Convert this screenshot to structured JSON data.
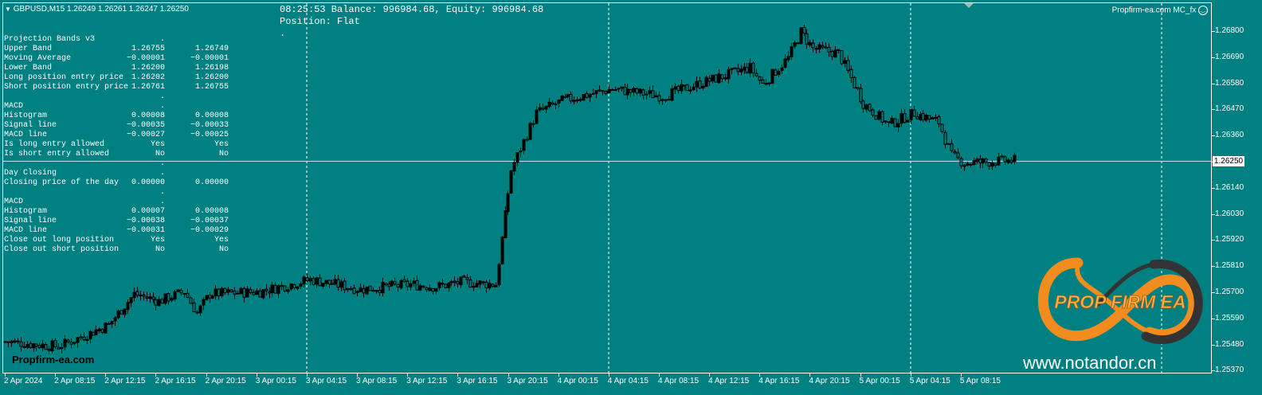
{
  "symbol_header": "GBPUSD,M15  1.26249 1.26261 1.26247 1.26250",
  "status": {
    "line1": "08:25:53 Balance: 996984.68, Equity: 996984.68",
    "line2": "Position: Flat",
    "line3": "."
  },
  "ea_name": "Propfirm-ea.com MC_fx",
  "current_price": "1.26250",
  "watermark_left": "Propfirm-ea.com",
  "watermark_right": "www.notandor.cn",
  "logo_text": "PROP FIRM EA",
  "colors": {
    "background": "#008080",
    "foreground": "#ffffff",
    "logo_orange": "#f28c1e",
    "logo_dark": "#333333"
  },
  "panel": {
    "rows": [
      {
        "label": "Projection Bands v3",
        "v1": ".",
        "v2": ""
      },
      {
        "label": "Upper Band",
        "v1": "1.26755",
        "v2": "1.26749"
      },
      {
        "label": "Moving Average",
        "v1": "−0.00001",
        "v2": "−0.00001"
      },
      {
        "label": "Lower Band",
        "v1": "1.26200",
        "v2": "1.26198"
      },
      {
        "label": "Long position entry price",
        "v1": "1.26202",
        "v2": "1.26200"
      },
      {
        "label": "Short position entry price",
        "v1": "1.26761",
        "v2": "1.26755"
      },
      {
        "label": "",
        "v1": ".",
        "v2": ""
      },
      {
        "label": "MACD",
        "v1": ".",
        "v2": ""
      },
      {
        "label": "Histogram",
        "v1": "0.00008",
        "v2": "0.00008"
      },
      {
        "label": "Signal line",
        "v1": "−0.00035",
        "v2": "−0.00033"
      },
      {
        "label": "MACD line",
        "v1": "−0.00027",
        "v2": "−0.00025"
      },
      {
        "label": "Is long entry allowed",
        "v1": "Yes",
        "v2": "Yes"
      },
      {
        "label": "Is short entry allowed",
        "v1": "No",
        "v2": "No"
      },
      {
        "label": "",
        "v1": ".",
        "v2": ""
      },
      {
        "label": "Day Closing",
        "v1": ".",
        "v2": ""
      },
      {
        "label": "Closing price of the day",
        "v1": "0.00000",
        "v2": "0.00000"
      },
      {
        "label": "",
        "v1": ".",
        "v2": ""
      },
      {
        "label": "MACD",
        "v1": ".",
        "v2": ""
      },
      {
        "label": "Histogram",
        "v1": "0.00007",
        "v2": "0.00008"
      },
      {
        "label": "Signal line",
        "v1": "−0.00038",
        "v2": "−0.00037"
      },
      {
        "label": "MACD line",
        "v1": "−0.00031",
        "v2": "−0.00029"
      },
      {
        "label": "Close out long position",
        "v1": "Yes",
        "v2": "Yes"
      },
      {
        "label": "Close out short position",
        "v1": "No",
        "v2": "No"
      }
    ]
  },
  "price_axis": {
    "ticks": [
      "1.26800",
      "1.26690",
      "1.26580",
      "1.26470",
      "1.26360",
      "1.26250",
      "1.26140",
      "1.26030",
      "1.25920",
      "1.25810",
      "1.25700",
      "1.25590",
      "1.25480",
      "1.25370"
    ]
  },
  "time_axis": {
    "ticks": [
      "2 Apr 2024",
      "2 Apr 08:15",
      "2 Apr 12:15",
      "2 Apr 16:15",
      "2 Apr 20:15",
      "3 Apr 00:15",
      "3 Apr 04:15",
      "3 Apr 08:15",
      "3 Apr 12:15",
      "3 Apr 16:15",
      "3 Apr 20:15",
      "4 Apr 00:15",
      "4 Apr 04:15",
      "4 Apr 08:15",
      "4 Apr 12:15",
      "4 Apr 16:15",
      "4 Apr 20:15",
      "5 Apr 00:15",
      "5 Apr 04:15",
      "5 Apr 08:15"
    ]
  },
  "chart_data": {
    "type": "candlestick",
    "ylim": [
      1.2537,
      1.2685
    ],
    "day_separators": [
      "3 Apr 2024",
      "4 Apr 2024",
      "5 Apr 2024"
    ],
    "close_path": [
      [
        "2 Apr 2024",
        1.2549
      ],
      [
        "2 Apr 04:15",
        1.2547
      ],
      [
        "2 Apr 08:15",
        1.2556
      ],
      [
        "2 Apr 10:15",
        1.2569
      ],
      [
        "2 Apr 12:15",
        1.2566
      ],
      [
        "2 Apr 14:15",
        1.257
      ],
      [
        "2 Apr 15:15",
        1.2561
      ],
      [
        "2 Apr 16:15",
        1.2569
      ],
      [
        "2 Apr 20:15",
        1.257
      ],
      [
        "3 Apr 00:15",
        1.2575
      ],
      [
        "3 Apr 04:15",
        1.2571
      ],
      [
        "3 Apr 08:15",
        1.2573
      ],
      [
        "3 Apr 10:15",
        1.2572
      ],
      [
        "3 Apr 12:15",
        1.2574
      ],
      [
        "3 Apr 15:00",
        1.2573
      ],
      [
        "3 Apr 16:15",
        1.2621
      ],
      [
        "3 Apr 18:15",
        1.2645
      ],
      [
        "3 Apr 20:15",
        1.265
      ],
      [
        "4 Apr 00:15",
        1.2655
      ],
      [
        "4 Apr 04:15",
        1.2652
      ],
      [
        "4 Apr 08:15",
        1.2659
      ],
      [
        "4 Apr 11:15",
        1.2664
      ],
      [
        "4 Apr 12:15",
        1.2657
      ],
      [
        "4 Apr 14:15",
        1.2668
      ],
      [
        "4 Apr 15:15",
        1.2679
      ],
      [
        "4 Apr 16:15",
        1.2672
      ],
      [
        "4 Apr 18:15",
        1.267
      ],
      [
        "4 Apr 20:15",
        1.2649
      ],
      [
        "4 Apr 22:15",
        1.264
      ],
      [
        "5 Apr 00:15",
        1.2645
      ],
      [
        "5 Apr 02:15",
        1.2641
      ],
      [
        "5 Apr 03:15",
        1.2627
      ],
      [
        "5 Apr 04:15",
        1.2624
      ],
      [
        "5 Apr 08:15",
        1.2625
      ]
    ]
  }
}
